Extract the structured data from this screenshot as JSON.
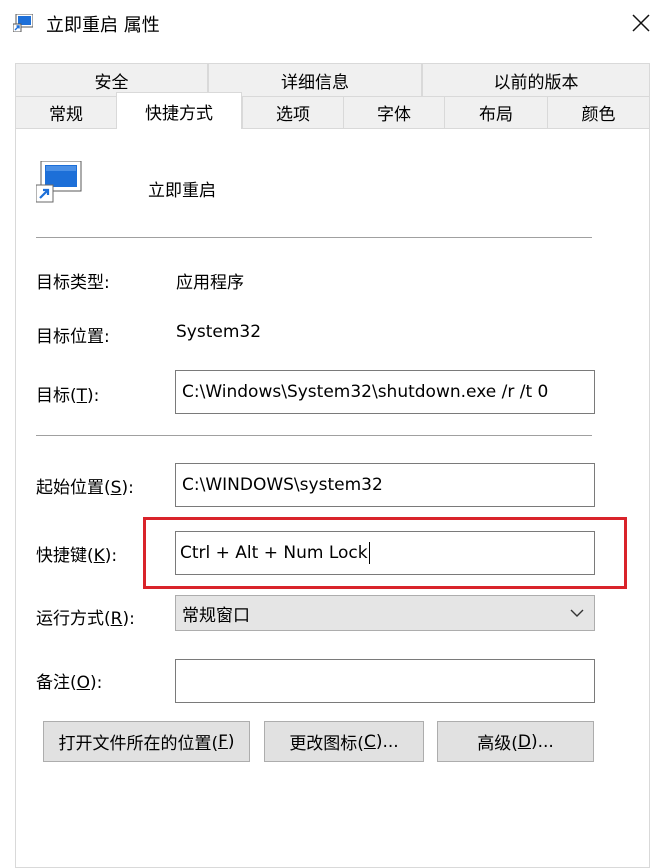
{
  "window": {
    "title": "立即重启 属性",
    "close_icon": "close-icon"
  },
  "tabs": {
    "row1": [
      "安全",
      "详细信息",
      "以前的版本"
    ],
    "row2": [
      "常规",
      "快捷方式",
      "选项",
      "字体",
      "布局",
      "颜色"
    ],
    "active": "快捷方式"
  },
  "shortcut": {
    "name": "立即重启",
    "icon": "shortcut-app-icon"
  },
  "properties": {
    "target_type_label": "目标类型:",
    "target_type_value": "应用程序",
    "target_location_label": "目标位置:",
    "target_location_value": "System32",
    "target_label_pre": "目标(",
    "target_label_key": "T",
    "target_label_post": "):",
    "target_value": "C:\\Windows\\System32\\shutdown.exe /r /t 0",
    "start_in_label_pre": "起始位置(",
    "start_in_label_key": "S",
    "start_in_label_post": "):",
    "start_in_value": "C:\\WINDOWS\\system32",
    "hotkey_label_pre": "快捷键(",
    "hotkey_label_key": "K",
    "hotkey_label_post": "):",
    "hotkey_value": "Ctrl + Alt + Num Lock",
    "run_label_pre": "运行方式(",
    "run_label_key": "R",
    "run_label_post": "):",
    "run_value": "常规窗口",
    "comment_label_pre": "备注(",
    "comment_label_key": "O",
    "comment_label_post": "):",
    "comment_value": ""
  },
  "buttons": {
    "open_location_pre": "打开文件所在的位置(",
    "open_location_key": "F",
    "open_location_post": ")",
    "change_icon_pre": "更改图标(",
    "change_icon_key": "C",
    "change_icon_post": ")...",
    "advanced_pre": "高级(",
    "advanced_key": "D",
    "advanced_post": ")..."
  },
  "colors": {
    "highlight": "#d9232a",
    "border": "#7a7a7a",
    "tab_bg": "#f0f0f0",
    "button_bg": "#e1e1e1"
  }
}
